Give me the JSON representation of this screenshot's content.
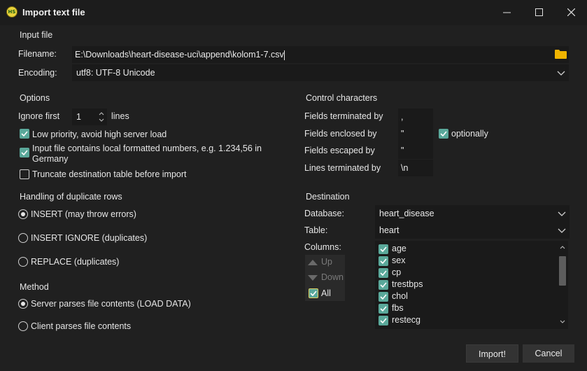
{
  "window": {
    "title": "Import text file",
    "icon_text": "HS",
    "minimize_icon": "minimize-icon",
    "maximize_icon": "maximize-icon",
    "close_icon": "close-icon"
  },
  "input_file": {
    "section": "Input file",
    "filename_label": "Filename:",
    "filename_value": "E:\\Downloads\\heart-disease-uci\\append\\kolom1-7.csv",
    "encoding_label": "Encoding:",
    "encoding_value": "utf8: UTF-8 Unicode"
  },
  "options": {
    "section": "Options",
    "ignore_first_label": "Ignore first",
    "ignore_first_value": "1",
    "lines_label": "lines",
    "low_priority": {
      "label": "Low priority, avoid high server load",
      "checked": true
    },
    "local_numbers": {
      "label_line1": "Input file contains local formatted numbers, e.g. 1.234,56 in",
      "label_line2": "Germany",
      "checked": true
    },
    "truncate": {
      "label": "Truncate destination table before import",
      "checked": false
    }
  },
  "duplicates": {
    "section": "Handling of duplicate rows",
    "items": [
      {
        "label": "INSERT (may throw errors)",
        "selected": true
      },
      {
        "label": "INSERT IGNORE (duplicates)",
        "selected": false
      },
      {
        "label": "REPLACE (duplicates)",
        "selected": false
      }
    ]
  },
  "method": {
    "section": "Method",
    "items": [
      {
        "label": "Server parses file contents (LOAD DATA)",
        "selected": true
      },
      {
        "label": "Client parses file contents",
        "selected": false
      }
    ]
  },
  "control_chars": {
    "section": "Control characters",
    "fields_terminated_label": "Fields terminated by",
    "fields_terminated_value": ",",
    "fields_enclosed_label": "Fields enclosed by",
    "fields_enclosed_value": "\"",
    "optionally_label": "optionally",
    "optionally_checked": true,
    "fields_escaped_label": "Fields escaped by",
    "fields_escaped_value": "\"",
    "lines_terminated_label": "Lines terminated by",
    "lines_terminated_value": "\\n"
  },
  "destination": {
    "section": "Destination",
    "database_label": "Database:",
    "database_value": "heart_disease",
    "table_label": "Table:",
    "table_value": "heart",
    "columns_label": "Columns:",
    "up_label": "Up",
    "down_label": "Down",
    "all_label": "All",
    "all_checked": true,
    "columns": [
      {
        "name": "age",
        "checked": true
      },
      {
        "name": "sex",
        "checked": true
      },
      {
        "name": "cp",
        "checked": true
      },
      {
        "name": "trestbps",
        "checked": true
      },
      {
        "name": "chol",
        "checked": true
      },
      {
        "name": "fbs",
        "checked": true
      },
      {
        "name": "restecg",
        "checked": true
      }
    ]
  },
  "buttons": {
    "import": "Import!",
    "cancel": "Cancel"
  },
  "colors": {
    "accent": "#5aa89a",
    "background": "#202020",
    "field": "#1a1a1a",
    "folder": "#f0b400"
  }
}
